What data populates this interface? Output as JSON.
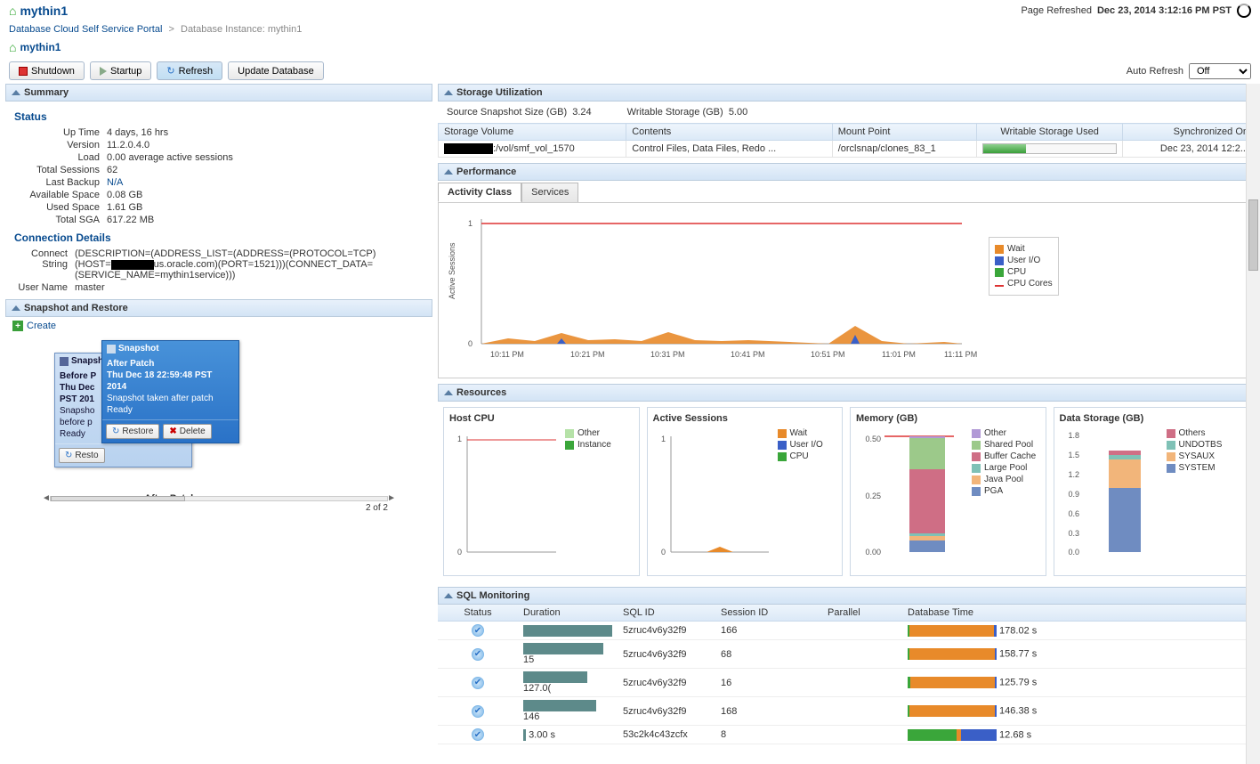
{
  "header": {
    "title": "mythin1",
    "page_refreshed_label": "Page Refreshed",
    "page_refreshed_time": "Dec 23, 2014 3:12:16 PM PST"
  },
  "breadcrumb": {
    "root": "Database Cloud Self Service Portal",
    "current": "Database Instance: mythin1"
  },
  "subheader": "mythin1",
  "toolbar": {
    "shutdown": "Shutdown",
    "startup": "Startup",
    "refresh": "Refresh",
    "update_db": "Update Database",
    "auto_refresh_label": "Auto Refresh",
    "auto_refresh_value": "Off"
  },
  "summary": {
    "title": "Summary",
    "status_label": "Status",
    "uptime_k": "Up Time",
    "uptime_v": "4 days, 16 hrs",
    "version_k": "Version",
    "version_v": "11.2.0.4.0",
    "load_k": "Load",
    "load_v": "0.00 average active sessions",
    "sessions_k": "Total Sessions",
    "sessions_v": "62",
    "lastbackup_k": "Last Backup",
    "lastbackup_v": "N/A",
    "avail_k": "Available Space",
    "avail_v": "0.08 GB",
    "used_k": "Used Space",
    "used_v": "1.61 GB",
    "sga_k": "Total SGA",
    "sga_v": "617.22 MB",
    "conn_hdr": "Connection Details",
    "connstr_k": "Connect String",
    "connstr_v1": "(DESCRIPTION=(ADDRESS_LIST=(ADDRESS=(PROTOCOL=TCP)",
    "connstr_v2a": "(HOST=",
    "connstr_v2b": "us.oracle.com)(PORT=1521)))(CONNECT_DATA=",
    "connstr_v3": "(SERVICE_NAME=mythin1service)))",
    "username_k": "User Name",
    "username_v": "master"
  },
  "snapshot": {
    "title": "Snapshot and Restore",
    "create": "Create",
    "back": {
      "hdr": "Snapshot",
      "name": "Before P",
      "date": "Thu Dec",
      "date2": "PST 201",
      "desc1": "Snapsho",
      "desc2": "before p",
      "ready": "Ready",
      "restore": "Resto"
    },
    "front": {
      "hdr": "Snapshot",
      "name": "After Patch",
      "date": "Thu Dec 18 22:59:48 PST 2014",
      "desc": "Snapshot taken after patch",
      "ready": "Ready",
      "restore": "Restore",
      "delete": "Delete"
    },
    "label": "After Patch",
    "pager": "2 of 2"
  },
  "storage": {
    "title": "Storage Utilization",
    "src_label": "Source Snapshot Size (GB)",
    "src_val": "3.24",
    "wr_label": "Writable Storage (GB)",
    "wr_val": "5.00",
    "cols": {
      "vol": "Storage Volume",
      "contents": "Contents",
      "mount": "Mount Point",
      "used": "Writable Storage Used",
      "sync": "Synchronized On"
    },
    "row": {
      "vol": ":/vol/smf_vol_1570",
      "contents": "Control Files, Data Files, Redo ...",
      "mount": "/orclsnap/clones_83_1",
      "sync": "Dec 23, 2014 12:2..."
    }
  },
  "perf": {
    "title": "Performance",
    "tab1": "Activity Class",
    "tab2": "Services",
    "ylabel": "Active Sessions",
    "legend": {
      "wait": "Wait",
      "uio": "User I/O",
      "cpu": "CPU",
      "cores": "CPU Cores"
    }
  },
  "chart_data": {
    "performance": {
      "type": "area",
      "xlabel": "",
      "ylabel": "Active Sessions",
      "x_ticks": [
        "10:11 PM",
        "10:21 PM",
        "10:31 PM",
        "10:41 PM",
        "10:51 PM",
        "11:01 PM",
        "11:11 PM"
      ],
      "y_ticks": [
        0,
        1
      ],
      "cpu_cores_line": 1,
      "series": [
        {
          "name": "Wait",
          "color": "#e88a2a",
          "values": [
            0.02,
            0.05,
            0.03,
            0.08,
            0.04,
            0.05,
            0.03,
            0.1,
            0.04,
            0.03,
            0.04,
            0.15,
            0.05,
            0.02
          ]
        },
        {
          "name": "User I/O",
          "color": "#3a5fc7",
          "values": [
            0,
            0,
            0,
            0.03,
            0,
            0,
            0,
            0,
            0,
            0,
            0,
            0.03,
            0,
            0
          ]
        },
        {
          "name": "CPU",
          "color": "#3aa63a",
          "values": [
            0,
            0,
            0,
            0,
            0,
            0,
            0,
            0,
            0,
            0,
            0,
            0,
            0,
            0
          ]
        }
      ]
    },
    "host_cpu": {
      "type": "area",
      "title": "Host CPU",
      "ylim": [
        0,
        1
      ],
      "y_ticks": [
        0,
        1
      ],
      "series": [
        {
          "name": "Other",
          "color": "#b6e2a8",
          "values": [
            0.01,
            0.01
          ]
        },
        {
          "name": "Instance",
          "color": "#3aa63a",
          "values": [
            0,
            0
          ]
        }
      ],
      "cores_line": 1
    },
    "active_sessions": {
      "type": "area",
      "title": "Active Sessions",
      "ylim": [
        0,
        1
      ],
      "y_ticks": [
        0,
        1
      ],
      "series": [
        {
          "name": "Wait",
          "color": "#e88a2a",
          "values": [
            0,
            0.05,
            0
          ]
        },
        {
          "name": "User I/O",
          "color": "#3a5fc7",
          "values": [
            0,
            0,
            0
          ]
        },
        {
          "name": "CPU",
          "color": "#3aa63a",
          "values": [
            0,
            0,
            0
          ]
        }
      ]
    },
    "memory": {
      "type": "bar",
      "title": "Memory (GB)",
      "ylim": [
        0,
        0.6
      ],
      "y_ticks": [
        0.0,
        0.25,
        0.5
      ],
      "stacks": [
        {
          "name": "Other",
          "color": "#b199d6",
          "value": 0.01
        },
        {
          "name": "Shared Pool",
          "color": "#9cc98a",
          "value": 0.17
        },
        {
          "name": "Buffer Cache",
          "color": "#cf6e85",
          "value": 0.33
        },
        {
          "name": "Large Pool",
          "color": "#7fc1b6",
          "value": 0.01
        },
        {
          "name": "Java Pool",
          "color": "#f2b57a",
          "value": 0.02
        },
        {
          "name": "PGA",
          "color": "#6f8cc1",
          "value": 0.06
        }
      ],
      "cores_line": 0.6
    },
    "data_storage": {
      "type": "bar",
      "title": "Data Storage (GB)",
      "ylim": [
        0,
        1.8
      ],
      "y_ticks": [
        0.0,
        0.3,
        0.6,
        0.9,
        1.2,
        1.5,
        1.8
      ],
      "stacks": [
        {
          "name": "Others",
          "color": "#cf6e85",
          "value": 0.07
        },
        {
          "name": "UNDOTBS",
          "color": "#7fc1b6",
          "value": 0.07
        },
        {
          "name": "SYSAUX",
          "color": "#f2b57a",
          "value": 0.45
        },
        {
          "name": "SYSTEM",
          "color": "#6f8cc1",
          "value": 1.0
        }
      ]
    }
  },
  "resources": {
    "title": "Resources",
    "host_cpu": "Host CPU",
    "active_sessions": "Active Sessions",
    "memory": "Memory (GB)",
    "data_storage": "Data Storage (GB)",
    "legend_hostcpu": {
      "other": "Other",
      "inst": "Instance"
    },
    "legend_as": {
      "wait": "Wait",
      "uio": "User I/O",
      "cpu": "CPU"
    },
    "legend_mem": {
      "other": "Other",
      "sp": "Shared Pool",
      "bc": "Buffer Cache",
      "lp": "Large Pool",
      "jp": "Java Pool",
      "pga": "PGA"
    },
    "legend_ds": {
      "ot": "Others",
      "un": "UNDOTBS",
      "sy": "SYSAUX",
      "st": "SYSTEM"
    }
  },
  "sql": {
    "title": "SQL Monitoring",
    "cols": {
      "status": "Status",
      "duration": "Duration",
      "sqlid": "SQL ID",
      "sess": "Session ID",
      "par": "Parallel",
      "dbt": "Database Time"
    },
    "rows": [
      {
        "dur_txt": "",
        "dur_w": 100,
        "sqlid": "5zruc4v6y32f9",
        "sess": "166",
        "dbt": "178.02 s",
        "seg": [
          [
            "#3aa63a",
            2
          ],
          [
            "#e88a2a",
            95
          ],
          [
            "#3a5fc7",
            3
          ]
        ]
      },
      {
        "dur_txt": "15",
        "dur_w": 90,
        "sqlid": "5zruc4v6y32f9",
        "sess": "68",
        "dbt": "158.77 s",
        "seg": [
          [
            "#3aa63a",
            2
          ],
          [
            "#e88a2a",
            96
          ],
          [
            "#3a5fc7",
            2
          ]
        ]
      },
      {
        "dur_txt": "127.0(",
        "dur_w": 72,
        "sqlid": "5zruc4v6y32f9",
        "sess": "16",
        "dbt": "125.79 s",
        "seg": [
          [
            "#3aa63a",
            3
          ],
          [
            "#e88a2a",
            95
          ],
          [
            "#3a5fc7",
            2
          ]
        ]
      },
      {
        "dur_txt": "146",
        "dur_w": 82,
        "sqlid": "5zruc4v6y32f9",
        "sess": "168",
        "dbt": "146.38 s",
        "seg": [
          [
            "#3aa63a",
            2
          ],
          [
            "#e88a2a",
            96
          ],
          [
            "#3a5fc7",
            2
          ]
        ]
      },
      {
        "dur_txt": "3.00 s",
        "dur_w": 3,
        "sqlid": "53c2k4c43zcfx",
        "sess": "8",
        "dbt": "12.68 s",
        "seg": [
          [
            "#3aa63a",
            55
          ],
          [
            "#e88a2a",
            5
          ],
          [
            "#3a5fc7",
            40
          ]
        ]
      }
    ]
  }
}
